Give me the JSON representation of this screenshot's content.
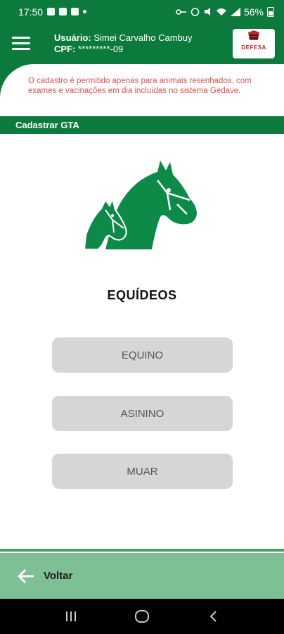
{
  "status_bar": {
    "time": "17:50",
    "battery": "56%"
  },
  "header": {
    "user_label": "Usuário:",
    "user_name": "Simei Carvalho Cambuy",
    "cpf_label": "CPF:",
    "cpf_value": "*********-09",
    "logo_text": "DEFESA"
  },
  "notice": "O cadastro é permitido apenas para animais  resenhados, com exames e vacinações em dia incluídas no sistema Gedave.",
  "section_title": "Cadastrar GTA",
  "main": {
    "title": "EQUÍDEOS",
    "options": [
      "EQUINO",
      "ASININO",
      "MUAR"
    ]
  },
  "footer": {
    "back_label": "Voltar"
  },
  "colors": {
    "primary": "#0d7a3d",
    "footer": "#7fbf95",
    "button": "#d6d6d6",
    "notice_text": "#d9534f"
  }
}
